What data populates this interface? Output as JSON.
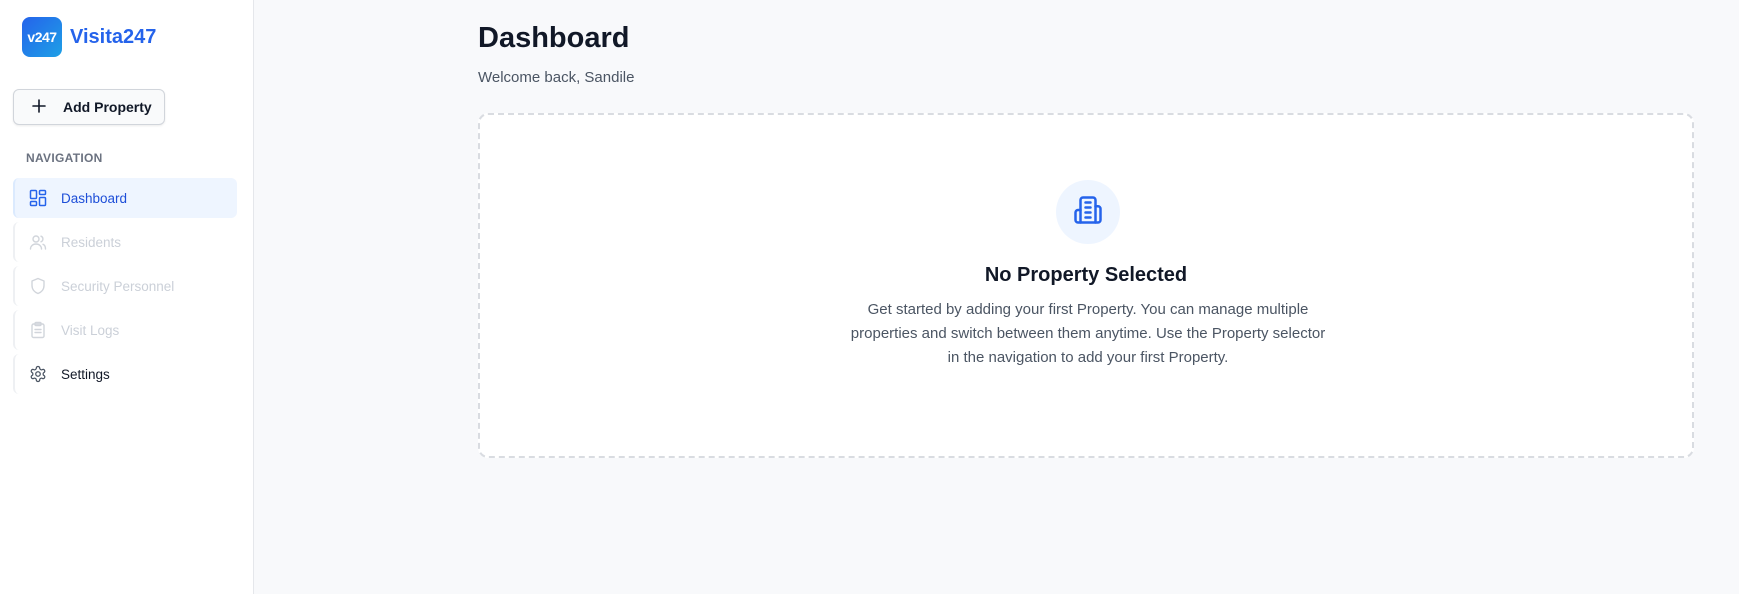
{
  "brand": {
    "logo_text": "v247",
    "name": "Visita247"
  },
  "sidebar": {
    "add_button_label": "Add Property",
    "nav_heading": "NAVIGATION",
    "items": [
      {
        "label": "Dashboard",
        "icon": "layout-grid-icon",
        "state": "active"
      },
      {
        "label": "Residents",
        "icon": "users-icon",
        "state": "disabled"
      },
      {
        "label": "Security Personnel",
        "icon": "shield-icon",
        "state": "disabled"
      },
      {
        "label": "Visit Logs",
        "icon": "clipboard-icon",
        "state": "disabled"
      },
      {
        "label": "Settings",
        "icon": "gear-icon",
        "state": "normal"
      }
    ]
  },
  "main": {
    "title": "Dashboard",
    "subtitle": "Welcome back, Sandile",
    "empty_state": {
      "icon": "building-icon",
      "title": "No Property Selected",
      "description": "Get started by adding your first Property. You can manage multiple properties and switch between them anytime. Use the Property selector in the navigation to add your first Property."
    }
  },
  "colors": {
    "accent": "#2563eb",
    "active_bg": "#eef5ff",
    "disabled_text": "#cbd0d8",
    "page_bg": "#f8f9fb"
  }
}
